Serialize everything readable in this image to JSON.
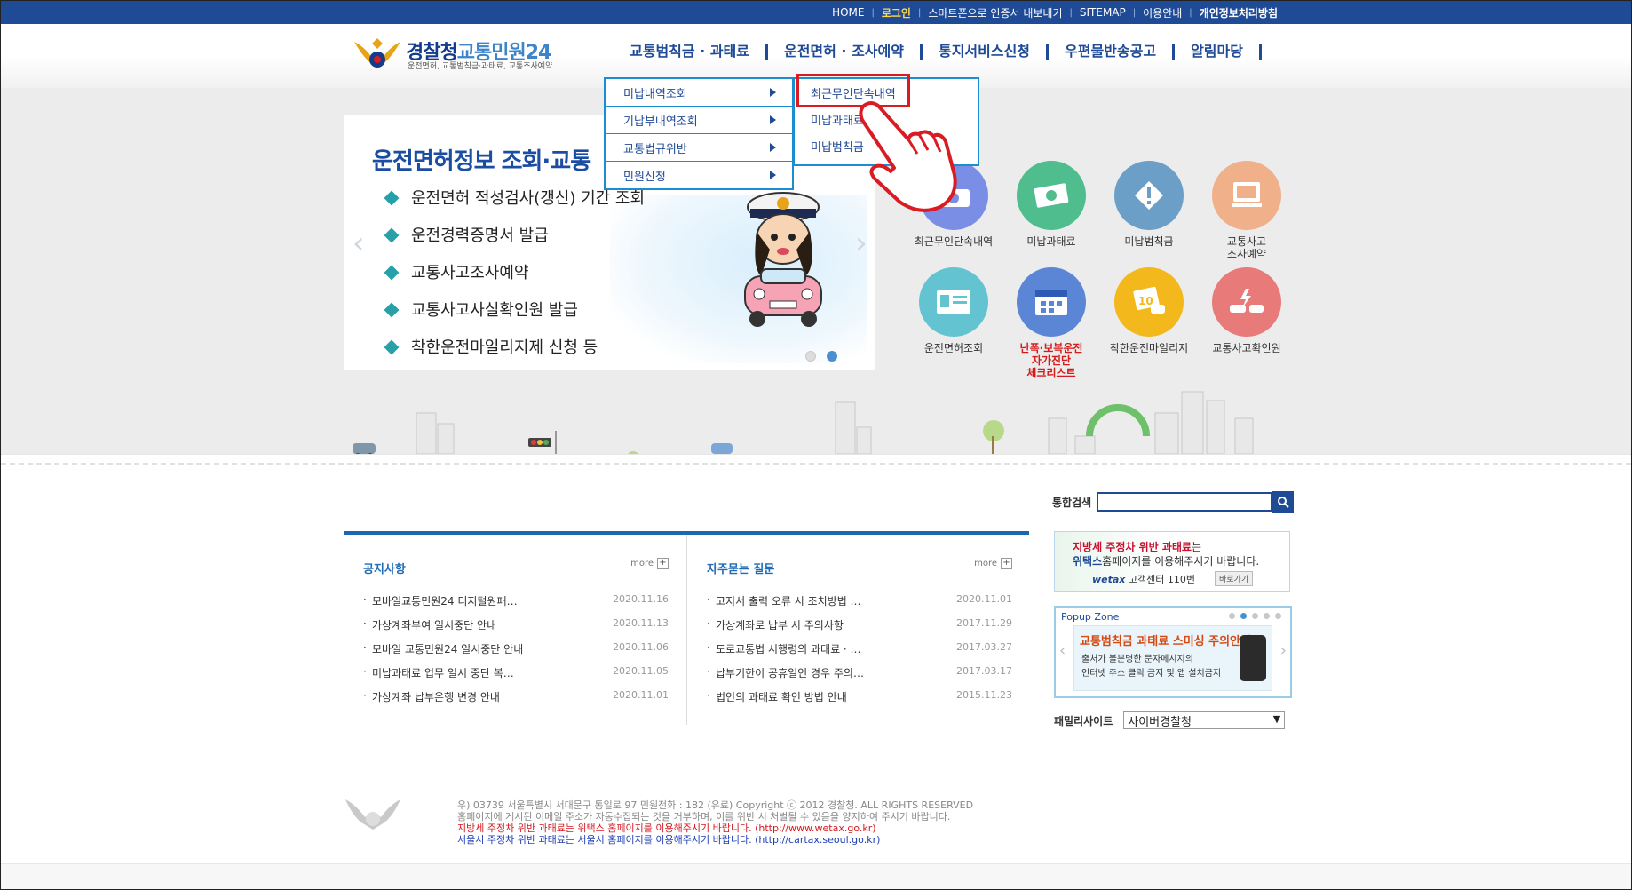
{
  "topbar": {
    "links": [
      "HOME",
      "로그인",
      "스마트폰으로 인증서 내보내기",
      "SITEMAP",
      "이용안내",
      "개인정보처리방침"
    ],
    "bg_color": "#1f4a96"
  },
  "header": {
    "logo_title_a": "경찰청",
    "logo_title_b": "교통민원24",
    "logo_sub": "운전면허, 교통범칙금·과태료, 교통조사예약",
    "nav": [
      "교통범칙금 · 과태료",
      "운전면허 · 조사예약",
      "통지서비스신청",
      "우편물반송공고",
      "알림마당"
    ]
  },
  "dropdown": {
    "level1": [
      "미납내역조회",
      "기납부내역조회",
      "교통법규위반",
      "민원신청"
    ],
    "level2": [
      "최근무인단속내역",
      "미납과태료",
      "미납범칙금"
    ],
    "highlight_color": "#d91c24"
  },
  "slider": {
    "heading": "운전면허정보 조회·교통",
    "items": [
      "운전면허 적성검사(갱신) 기간 조회",
      "운전경력증명서 발급",
      "교통사고조사예약",
      "교통사고사실확인원 발급",
      "착한운전마일리지제 신청 등"
    ],
    "prev": "‹",
    "next": "›"
  },
  "quick": [
    {
      "label": "최근무인단속내역",
      "color": "#7a8ee6",
      "icon": "camera-icon"
    },
    {
      "label": "미납과태료",
      "color": "#4fbd8d",
      "icon": "money-icon"
    },
    {
      "label": "미납범칙금",
      "color": "#6b9fc7",
      "icon": "warning-icon"
    },
    {
      "label": "교통사고\n조사예약",
      "color": "#f0b08a",
      "icon": "monitor-icon"
    },
    {
      "label": "운전면허조회",
      "color": "#63c3d0",
      "icon": "license-icon"
    },
    {
      "label": "난폭·보복운전\n자가진단\n체크리스트",
      "color": "#5b86d6",
      "icon": "checklist-icon"
    },
    {
      "label": "착한운전마일리지",
      "color": "#f3b81c",
      "icon": "mileage-icon"
    },
    {
      "label": "교통사고확인원",
      "color": "#e87a7a",
      "icon": "accident-icon"
    }
  ],
  "notice": {
    "title": "공지사항",
    "more": "more",
    "items": [
      {
        "title": "모바일교통민원24 디지털원패…",
        "date": "2020.11.16"
      },
      {
        "title": "가상계좌부여 일시중단 안내",
        "date": "2020.11.13"
      },
      {
        "title": "모바일 교통민원24 일시중단 안내",
        "date": "2020.11.06"
      },
      {
        "title": "미납과태료 업무 일시 중단 복…",
        "date": "2020.11.05"
      },
      {
        "title": "가상계좌 납부은행 변경 안내",
        "date": "2020.11.01"
      }
    ]
  },
  "faq": {
    "title": "자주묻는 질문",
    "more": "more",
    "items": [
      {
        "title": "고지서 출력 오류 시 조치방법 …",
        "date": "2020.11.01"
      },
      {
        "title": "가상계좌로 납부 시 주의사항",
        "date": "2017.11.29"
      },
      {
        "title": "도로교통법 시행령의 과태료 · …",
        "date": "2017.03.27"
      },
      {
        "title": "납부기한이 공휴일인 경우 주의…",
        "date": "2017.03.17"
      },
      {
        "title": "법인의 과태료 확인 방법 안내",
        "date": "2015.11.23"
      }
    ]
  },
  "search": {
    "label": "통합검색",
    "value": ""
  },
  "banner_wetax": {
    "l1_red": "지방세 주정차 위반 과태료",
    "l1_rest": "는",
    "l2_bold": "위택스",
    "l2_rest": "홈페이지를 이용해주시기 바랍니다.",
    "l3_logo": "wetax",
    "l3_rest": " 고객센터 110번",
    "go": "바로가기"
  },
  "popup": {
    "title": "Popup Zone",
    "line1": "교통범칙금 과태료 스미싱 주의안내",
    "line2": "출처가 불분명한 문자메시지의",
    "line3": "인터넷 주소 클릭 금지 및 앱 설치금지"
  },
  "family": {
    "label": "패밀리사이트",
    "selected": "사이버경찰청"
  },
  "footer": {
    "line1": "우) 03739 서울특별시 서대문구 통일로 97  민원전화 : 182 (유료)         Copyright ⓒ 2012 경찰청. ALL RIGHTS RESERVED",
    "line2": "홈페이지에 게시된 이메일 주소가 자동수집되는 것을 거부하며, 이를 위반 시 처벌될 수 있음을 양지하여 주시기 바랍니다.",
    "line3": "지방세 주정차 위반 과태료는 위택스 홈페이지를 이용해주시기 바랍니다. (http://www.wetax.go.kr)",
    "line4": "서울시 주정차 위반 과태료는 서울시 홈페이지를 이용해주시기 바랍니다. (http://cartax.seoul.go.kr)"
  }
}
